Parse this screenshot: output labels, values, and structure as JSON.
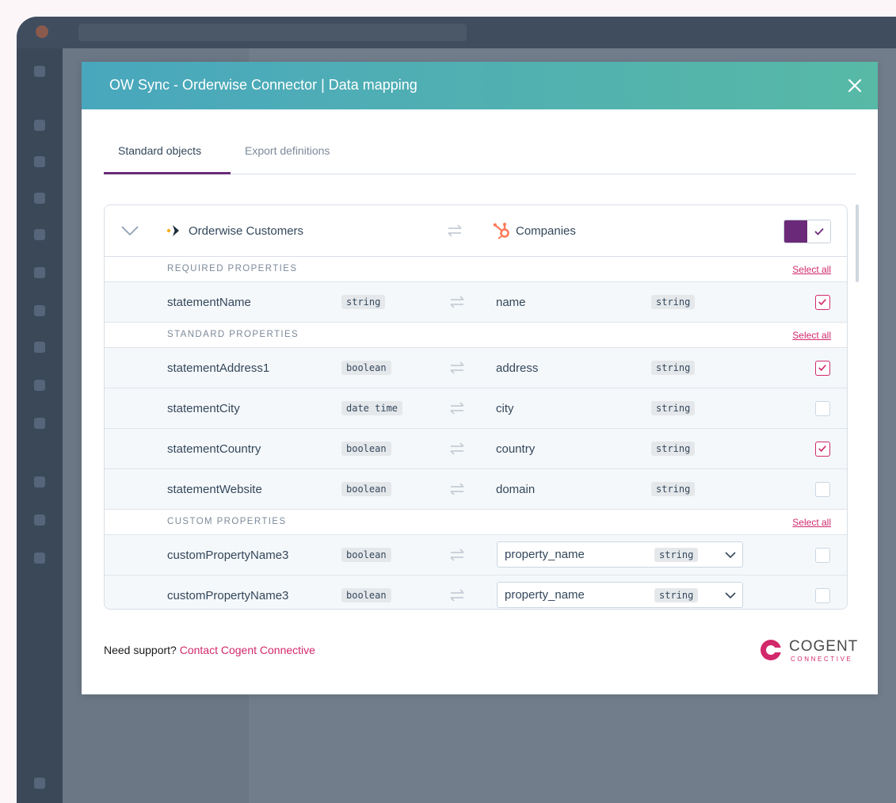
{
  "modal": {
    "title": "OW Sync - Orderwise Connector | Data mapping",
    "tabs": [
      {
        "label": "Standard objects"
      },
      {
        "label": "Export definitions"
      }
    ]
  },
  "mapping": {
    "source_object": "Orderwise Customers",
    "target_object": "Companies",
    "enabled": true,
    "sections": [
      {
        "label": "REQUIRED PROPERTIES",
        "select_all": "Select all",
        "rows": [
          {
            "source": "statementName",
            "source_type": "string",
            "target": "name",
            "target_type": "string",
            "checked": true
          }
        ]
      },
      {
        "label": "STANDARD PROPERTIES",
        "select_all": "Select all",
        "rows": [
          {
            "source": "statementAddress1",
            "source_type": "boolean",
            "target": "address",
            "target_type": "string",
            "checked": true
          },
          {
            "source": "statementCity",
            "source_type": "date time",
            "target": "city",
            "target_type": "string",
            "checked": false
          },
          {
            "source": "statementCountry",
            "source_type": "boolean",
            "target": "country",
            "target_type": "string",
            "checked": true
          },
          {
            "source": "statementWebsite",
            "source_type": "boolean",
            "target": "domain",
            "target_type": "string",
            "checked": false
          }
        ]
      },
      {
        "label": "CUSTOM PROPERTIES",
        "select_all": "Select all",
        "rows": [
          {
            "source": "customPropertyName3",
            "source_type": "boolean",
            "target": "property_name",
            "target_type": "string",
            "checked": false
          },
          {
            "source": "customPropertyName3",
            "source_type": "boolean",
            "target": "property_name",
            "target_type": "string",
            "checked": false
          }
        ]
      }
    ]
  },
  "footer": {
    "prompt": "Need support?",
    "link": "Contact Cogent Connective"
  },
  "brand": {
    "name": "COGENT",
    "tagline": "CONNECTIVE"
  },
  "colors": {
    "header_gradient_start": "#49a7bd",
    "header_gradient_end": "#57b9a6",
    "accent_purple": "#6b2a79",
    "accent_pink": "#d1296b",
    "text_dark": "#33475b"
  },
  "icons": [
    "close-icon",
    "chevron-down-icon",
    "orderwise-logo-icon",
    "swap-arrows-icon",
    "hubspot-logo-icon",
    "check-icon",
    "cogent-logo-icon"
  ]
}
